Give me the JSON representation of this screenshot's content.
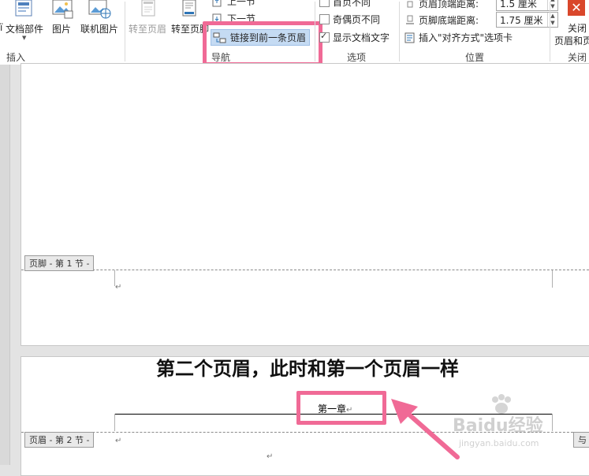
{
  "ribbon": {
    "insert_group": {
      "doc_parts_label": "文档部件",
      "picture_label": "图片",
      "online_picture_label": "联机图片",
      "group_label": "插入"
    },
    "nav_group": {
      "goto_header_label": "转至页眉",
      "goto_footer_label": "转至页脚",
      "prev_section_label": "上一节",
      "next_section_label": "下一节",
      "link_previous_label": "链接到前一条页眉",
      "group_label": "导航"
    },
    "options_group": {
      "first_page_label": "首页不同",
      "odd_even_label": "奇偶页不同",
      "show_doc_text_label": "显示文档文字",
      "show_doc_text_checked": true,
      "group_label": "选项"
    },
    "position_group": {
      "header_top_label": "页眉顶端距离:",
      "header_top_value": "1.5 厘米",
      "footer_bottom_label": "页脚底端距离:",
      "footer_bottom_value": "1.75 厘米",
      "insert_align_tab_label": "插入\"对齐方式\"选项卡",
      "group_label": "位置"
    },
    "close_group": {
      "close_label_line1": "关闭",
      "close_label_line2": "页眉和页脚",
      "group_label": "关闭"
    }
  },
  "document": {
    "footer_tag_label": "页脚 - 第 1 节 -",
    "header_tag_label": "页眉 - 第 2 节 -",
    "same_as_prev_tag_label": "与",
    "header_text": "第一章",
    "paragraph_mark": "↵",
    "annotation_text": "第二个页眉，此时和第一个页眉一样"
  },
  "watermark": {
    "brand": "Baidu经验",
    "url": "jingyan.baidu.com"
  },
  "colors": {
    "highlight": "#f06a96",
    "close_button": "#d9472b",
    "link_button_bg": "#c5dbf3"
  }
}
